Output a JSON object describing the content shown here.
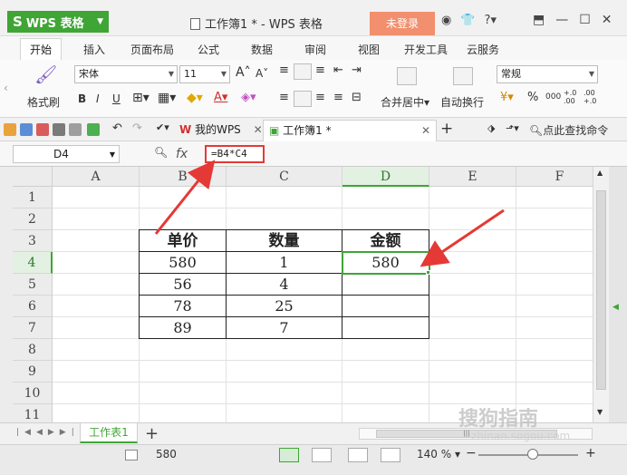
{
  "titlebar": {
    "app_name": "WPS 表格",
    "document_title": "工作簿1 * - WPS 表格",
    "login_label": "未登录",
    "help_label": "?"
  },
  "ribbon_tabs": [
    "开始",
    "插入",
    "页面布局",
    "公式",
    "数据",
    "审阅",
    "视图",
    "开发工具",
    "云服务"
  ],
  "ribbon": {
    "format_painter": "格式刷",
    "font_name": "宋体",
    "font_size": "11",
    "bold": "B",
    "italic": "I",
    "underline": "U",
    "merge_center": "合并居中",
    "wrap_text": "自动换行",
    "number_format": "常规",
    "percent": "%",
    "comma": "000",
    "inc_decimal": "+.0 .00",
    "dec_decimal": ".00 +.0"
  },
  "quick_access": {
    "my_wps_tab": "我的WPS",
    "workbook_tab": "工作簿1 *",
    "search_label": "点此查找命令"
  },
  "formula_bar": {
    "cell_ref": "D4",
    "fx_label": "fx",
    "formula": "=B4*C4"
  },
  "grid": {
    "columns": [
      "A",
      "B",
      "C",
      "D",
      "E",
      "F"
    ],
    "rows": [
      "1",
      "2",
      "3",
      "4",
      "5",
      "6",
      "7",
      "8",
      "9",
      "10",
      "11"
    ],
    "selected_col": "D",
    "selected_row": "4",
    "table_headers": [
      "单价",
      "数量",
      "金额"
    ],
    "table_rows": [
      [
        "580",
        "1",
        "580"
      ],
      [
        "56",
        "4",
        ""
      ],
      [
        "78",
        "25",
        ""
      ],
      [
        "89",
        "7",
        ""
      ]
    ]
  },
  "sheetbar": {
    "sheet_tab": "工作表1",
    "add_sheet": "+"
  },
  "statusbar": {
    "selection_value": "580",
    "zoom_label": "140 %"
  },
  "watermark": {
    "brand": "搜狗指南",
    "url": "zhinan.sogou.com"
  },
  "colors": {
    "accent_green": "#3fa535",
    "login_orange": "#f28f6e",
    "annotation_red": "#e53935"
  }
}
